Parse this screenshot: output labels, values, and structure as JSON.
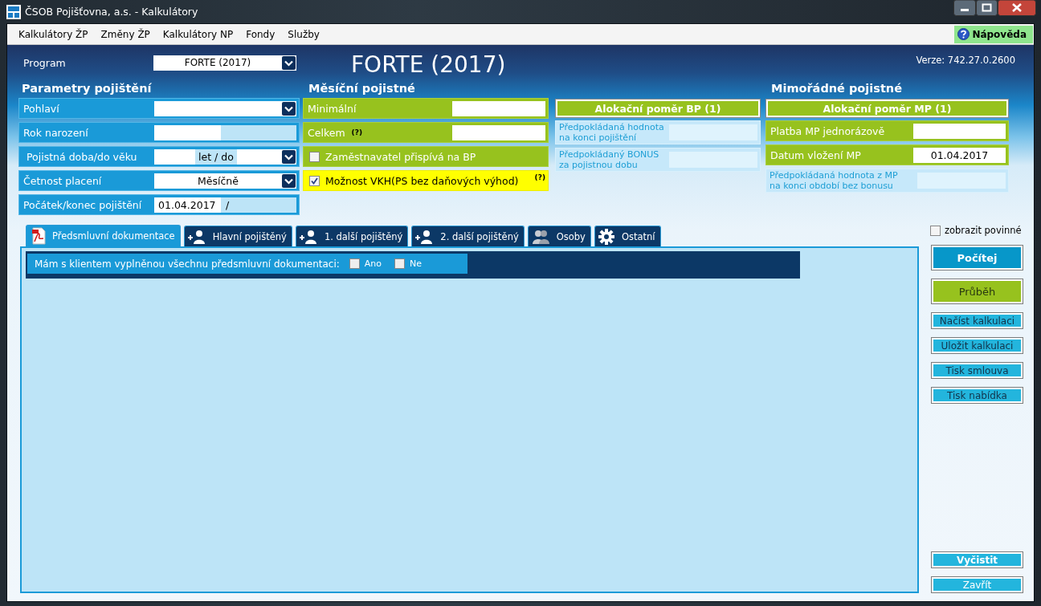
{
  "window": {
    "title": "ČSOB Pojišťovna, a.s. - Kalkulátory"
  },
  "menu": {
    "items": [
      "Kalkulátory ŽP",
      "Změny ŽP",
      "Kalkulátory NP",
      "Fondy",
      "Služby"
    ],
    "help": "Nápověda"
  },
  "program": {
    "label": "Program",
    "value": "FORTE (2017)"
  },
  "heading": "FORTE (2017)",
  "version": "Verze: 742.27.0.2600",
  "parameters": {
    "title": "Parametry pojištění",
    "fields": [
      {
        "kind": "select",
        "label": "Pohlaví"
      },
      {
        "kind": "split",
        "label": "Rok narození"
      },
      {
        "kind": "duration",
        "label": "Pojistná doba/do věku",
        "unit": "let / do"
      },
      {
        "kind": "select",
        "label": "Četnost placení",
        "value": "Měsíčně"
      },
      {
        "kind": "split",
        "label": "Počátek/konec pojištění",
        "value": "01.04.2017",
        "rest": "/"
      }
    ]
  },
  "monthly": {
    "title": "Měsíční pojistné",
    "fields": [
      {
        "kind": "input",
        "label": "Minimální"
      },
      {
        "kind": "input",
        "label": "Celkem",
        "hint": "(?)"
      },
      {
        "kind": "check",
        "label": "Zaměstnavatel přispívá na BP",
        "checked": false
      },
      {
        "kind": "check",
        "label": "Možnost VKH(PS bez daňových výhod)",
        "checked": true,
        "hint": "(?)"
      }
    ]
  },
  "basic_allocation": {
    "button": "Alokační poměr BP (1)",
    "fields": [
      {
        "kind": "info",
        "label": "Předpokládaná hodnota\nna konci pojištění"
      },
      {
        "kind": "info",
        "label": "Předpokládaný BONUS\nza pojistnou dobu"
      }
    ]
  },
  "extra": {
    "title": "Mimořádné pojistné",
    "button": "Alokační poměr MP (1)",
    "fields": [
      {
        "kind": "input",
        "label": "Platba MP jednorázově"
      },
      {
        "kind": "input",
        "label": "Datum vložení MP",
        "value": "01.04.2017"
      },
      {
        "kind": "info",
        "label": "Předpokládaná hodnota z MP\nna konci období bez bonusu"
      }
    ]
  },
  "tabs": [
    {
      "kind": "pdf",
      "label": "Předsmluvní dokumentace",
      "selected": true
    },
    {
      "kind": "add-person",
      "label": "Hlavní pojištěný",
      "selected": false
    },
    {
      "kind": "add-person",
      "label": "1. další pojištěný",
      "selected": false
    },
    {
      "kind": "add-person",
      "label": "2. další pojištěný",
      "selected": false
    },
    {
      "kind": "people",
      "label": "Osoby",
      "selected": false
    },
    {
      "kind": "gear",
      "label": "Ostatní",
      "selected": false
    }
  ],
  "documents": {
    "question": "Mám s klientem vyplněnou všechnu předsmluvní dokumentaci:",
    "options": [
      {
        "label": "Ano",
        "checked": false
      },
      {
        "label": "Ne",
        "checked": false
      }
    ]
  },
  "sidebar": {
    "show_required": {
      "label": "zobrazit povinné",
      "checked": false
    },
    "buttons": [
      {
        "kind": "primary",
        "label": "Počítej"
      },
      {
        "kind": "green",
        "label": "Průběh"
      },
      {
        "kind": "small",
        "label": "Načíst kalkulaci"
      },
      {
        "kind": "small",
        "label": "Uložit kalkulaci"
      },
      {
        "kind": "small",
        "label": "Tisk smlouva"
      },
      {
        "kind": "small",
        "label": "Tisk nabídka"
      }
    ],
    "bottom_buttons": [
      {
        "kind": "small-bold",
        "label": "Vyčistit"
      },
      {
        "kind": "small",
        "label": "Zavřít"
      }
    ]
  }
}
